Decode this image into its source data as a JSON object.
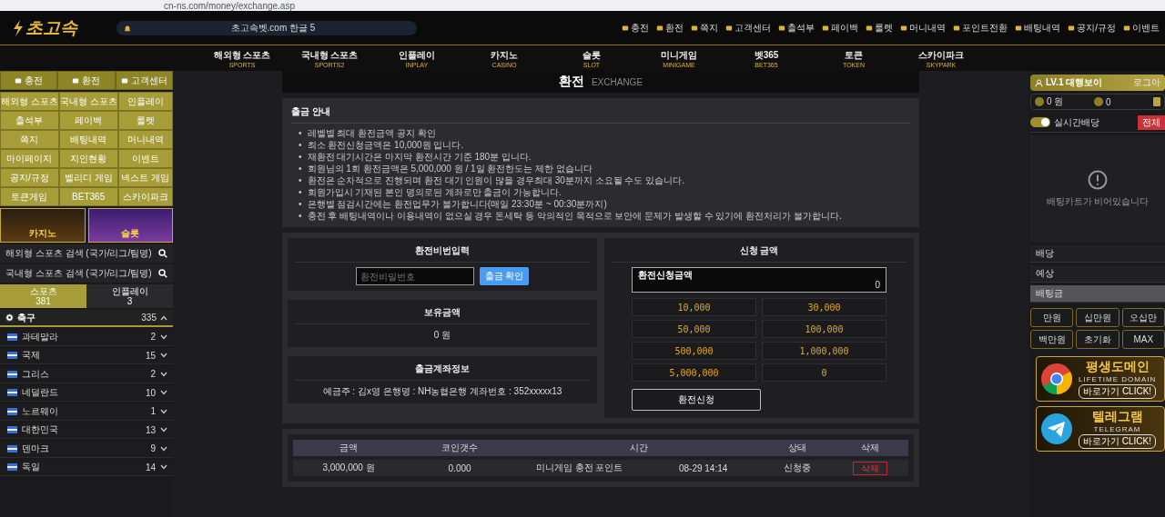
{
  "browser": {
    "url": "cn-ns.com/money/exchange.asp"
  },
  "header": {
    "logo": "초고속",
    "notice": "초고속벳.com 한글 5",
    "top_links": [
      "충전",
      "환전",
      "쪽지",
      "고객센터",
      "출석부",
      "페이백",
      "룰렛",
      "머니내역",
      "포인트전환",
      "배팅내역",
      "공지/규정",
      "이벤트"
    ]
  },
  "nav": [
    {
      "label": "해외형 스포츠",
      "sub": "SPORTS"
    },
    {
      "label": "국내형 스포츠",
      "sub": "SPORTS2"
    },
    {
      "label": "인플레이",
      "sub": "INPLAY"
    },
    {
      "label": "카지노",
      "sub": "CASINO"
    },
    {
      "label": "슬롯",
      "sub": "SLOT"
    },
    {
      "label": "미니게임",
      "sub": "MINIGAME"
    },
    {
      "label": "벳365",
      "sub": "BET365"
    },
    {
      "label": "토큰",
      "sub": "TOKEN"
    },
    {
      "label": "스카이파크",
      "sub": "SKYPARK"
    }
  ],
  "sidebar": {
    "quick": [
      "충전",
      "환전",
      "고객센터"
    ],
    "menu": [
      "해외형 스포츠",
      "국내형 스포츠",
      "인플레이",
      "출석부",
      "페이백",
      "룰렛",
      "쪽지",
      "배팅내역",
      "머니내역",
      "마이페이지",
      "지인현황",
      "이벤트",
      "공지/규정",
      "벨리디 게임",
      "넥스트 게임",
      "토큰게임",
      "BET365",
      "스카이파크"
    ],
    "banners": [
      "카지노",
      "슬롯"
    ],
    "searches": [
      "해외형 스포츠 검색 (국가/리그/팀명)",
      "국내형 스포츠 검색 (국가/리그/팀명)"
    ],
    "tabs": [
      {
        "label": "스포츠",
        "count": "381",
        "selected": true
      },
      {
        "label": "인플레이",
        "count": "3",
        "selected": false
      }
    ],
    "league": {
      "name": "축구",
      "count": "335",
      "expanded": true
    },
    "countries": [
      {
        "name": "과테말라",
        "count": "2",
        "expanded": false
      },
      {
        "name": "국제",
        "count": "15",
        "expanded": false
      },
      {
        "name": "그리스",
        "count": "2",
        "expanded": false
      },
      {
        "name": "네덜란드",
        "count": "10",
        "expanded": false
      },
      {
        "name": "노르웨이",
        "count": "1",
        "expanded": false
      },
      {
        "name": "대한민국",
        "count": "13",
        "expanded": false
      },
      {
        "name": "덴마크",
        "count": "9",
        "expanded": false
      },
      {
        "name": "독일",
        "count": "14",
        "expanded": false
      }
    ]
  },
  "main": {
    "title": "환전",
    "subtitle": "EXCHANGE",
    "notice": {
      "title": "출금 안내",
      "marker": "•",
      "items": [
        "레벨별 최대 환전금액 공지 확인",
        "최소 환전신청금액은 10,000원 입니다.",
        "재환전 대기시간은 마지막 환전시간 기준 180분 입니다.",
        "회원님의 1회 환전금액은 5,000,000 원 / 1일 환전한도는 제한 없습니다",
        "환전은 순차적으로 진행되며 환전 대기 인원이 많을 경우최대 30분까지 소요될 수도 있습니다.",
        "회원가입시 기재된 본인 명의로된 계좌로만 출금이 가능합니다.",
        "은행별 점검시간에는 환전업무가 불가합니다(매일 23:30분 ~ 00:30분까지)",
        "충전 후 배팅내역이나 이용내역이 없으실 경우 돈세탁 등 악의적인 목적으로 보안에 문제가 발생할 수 있기에 환전처리가 불가합니다."
      ]
    },
    "password": {
      "title": "환전비번입력",
      "placeholder": "환전비밀번호",
      "button": "출금 확인"
    },
    "balance": {
      "title": "보유금액",
      "value": "0 원"
    },
    "account": {
      "title": "출금계좌정보",
      "text": "예금주 : 김x영 은행명 : NH농협은행 계좌번호 : 352xxxxx13"
    },
    "request": {
      "title": "신청 금액",
      "field_label": "환전신청금액",
      "field_value": "0",
      "amounts": [
        "10,000",
        "30,000",
        "50,000",
        "100,000",
        "500,000",
        "1,000,000",
        "5,000,000",
        "0"
      ],
      "submit": "환전신청"
    },
    "history": {
      "columns": [
        "금액",
        "코인갯수",
        "시간",
        "상태",
        "삭제"
      ],
      "rows": [
        {
          "amount": "3,000,000 원",
          "coins": "0.000",
          "type": "미니게임 충전 포인트",
          "time": "08-29 14:14",
          "status": "신청중",
          "action": "삭제"
        }
      ]
    }
  },
  "betslip": {
    "user": "LV.1 대행보이",
    "logout": "로그아",
    "cash": "0 원",
    "point": "0",
    "live_odds": {
      "label": "실시간배당",
      "on": true
    },
    "clear": "전체",
    "empty": "배팅카트가 비어있습니다",
    "rows": [
      "배당",
      "예상",
      "배팅금"
    ],
    "amount_buttons": [
      "만원",
      "십만원",
      "오십만",
      "백만원",
      "초기화",
      "MAX"
    ],
    "banners": [
      {
        "kind": "chrome",
        "title": "평생도메인",
        "sub": "LIFETIME DOMAIN",
        "cta": "바로가기 CLICK!"
      },
      {
        "kind": "telegram",
        "title": "텔레그램",
        "sub": "TELEGRAM",
        "cta": "바로가기 CLICK!"
      }
    ]
  }
}
